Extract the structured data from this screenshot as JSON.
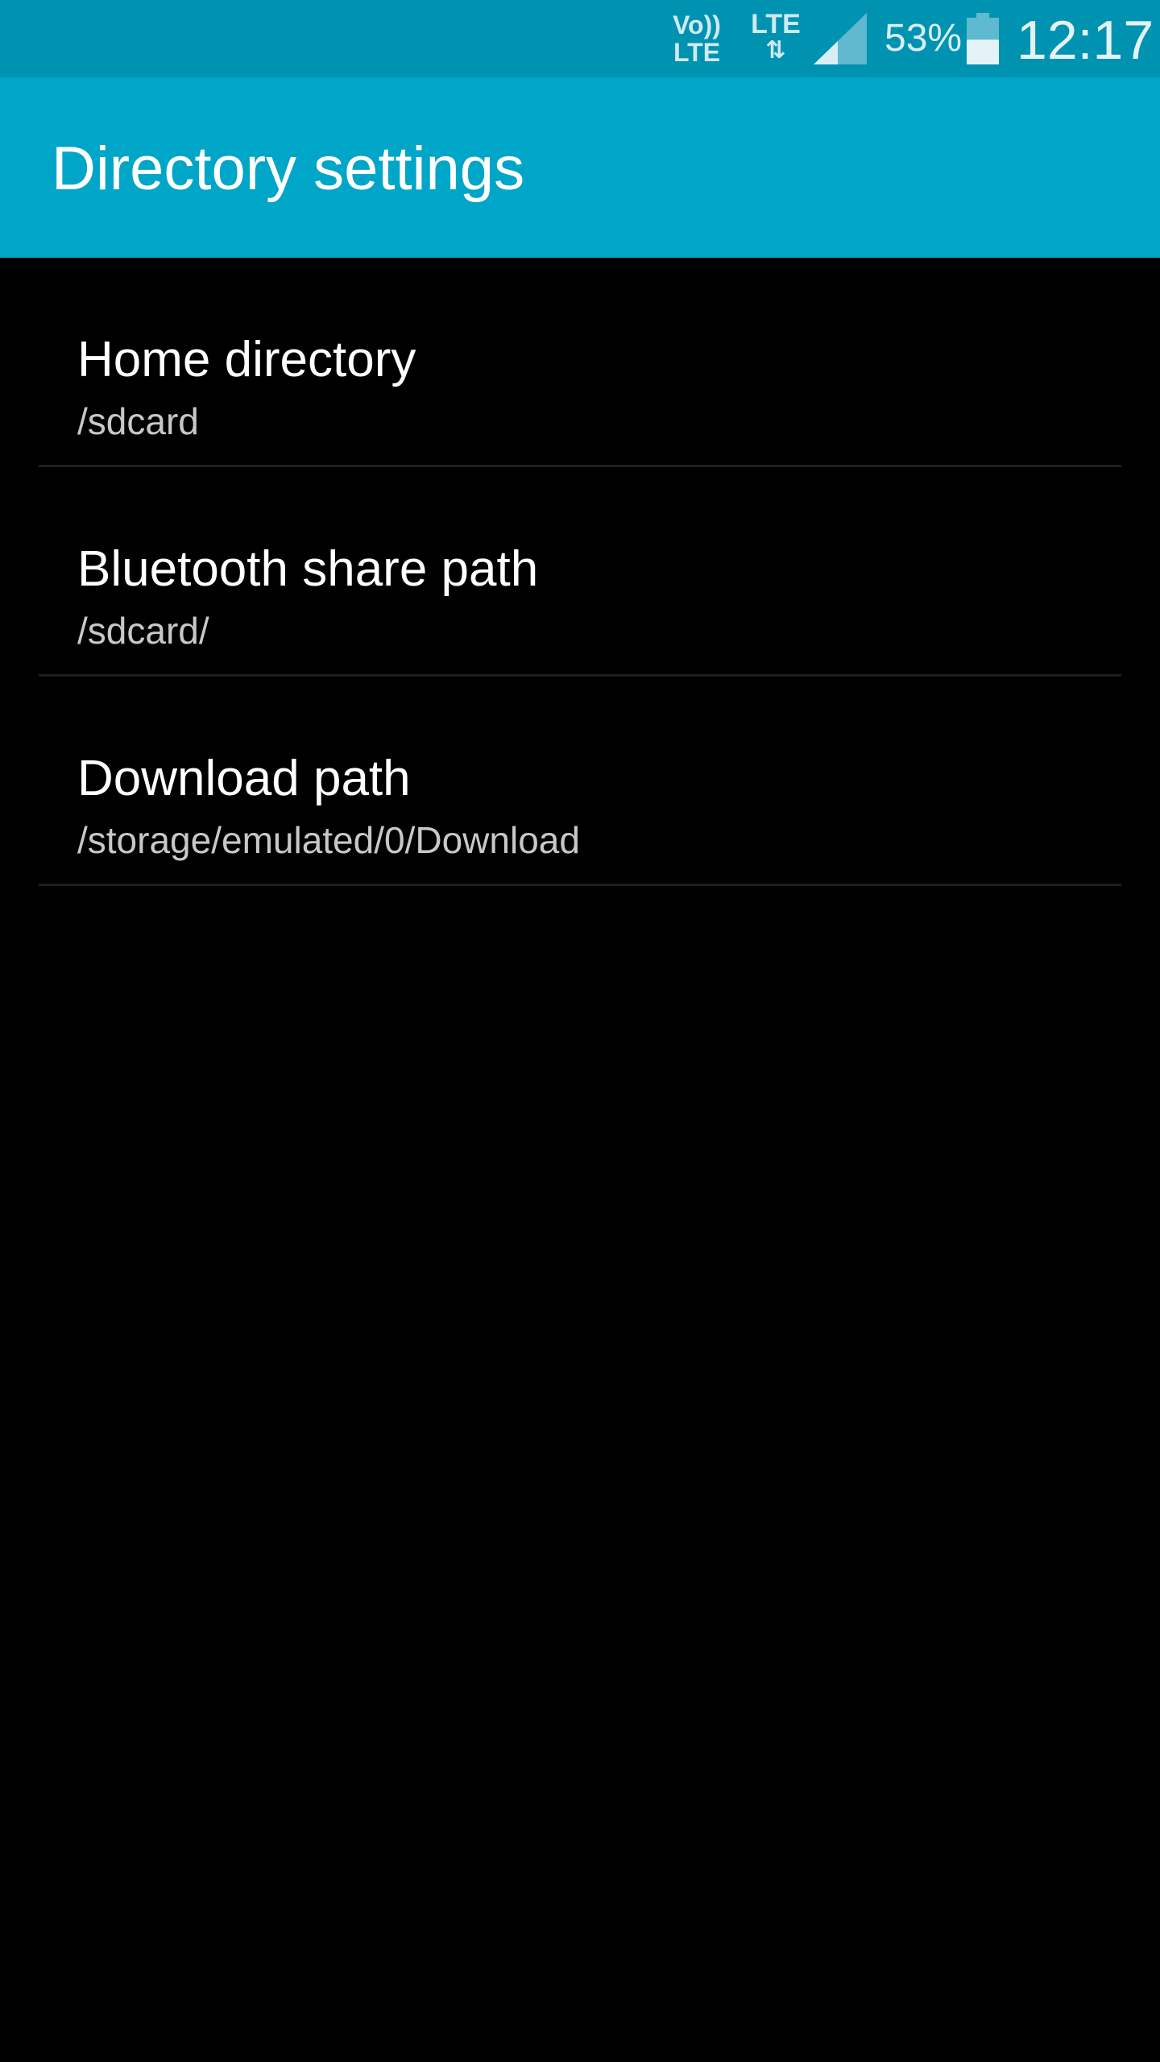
{
  "status_bar": {
    "volte_top": "Vo))",
    "volte_bottom": "LTE",
    "network_label": "LTE",
    "data_arrows": "⇅",
    "battery_percent": "53%",
    "battery_level": 0.53,
    "clock": "12:17"
  },
  "app_bar": {
    "title": "Directory settings"
  },
  "settings": {
    "items": [
      {
        "title": "Home directory",
        "summary": "/sdcard"
      },
      {
        "title": "Bluetooth share path",
        "summary": "/sdcard/"
      },
      {
        "title": "Download path",
        "summary": "/storage/emulated/0/Download"
      }
    ]
  },
  "colors": {
    "status_bar": "#0093b1",
    "app_bar": "#00a6c7",
    "background": "#000000",
    "divider": "#1f1f1f",
    "summary_text": "#c8c8c8"
  }
}
